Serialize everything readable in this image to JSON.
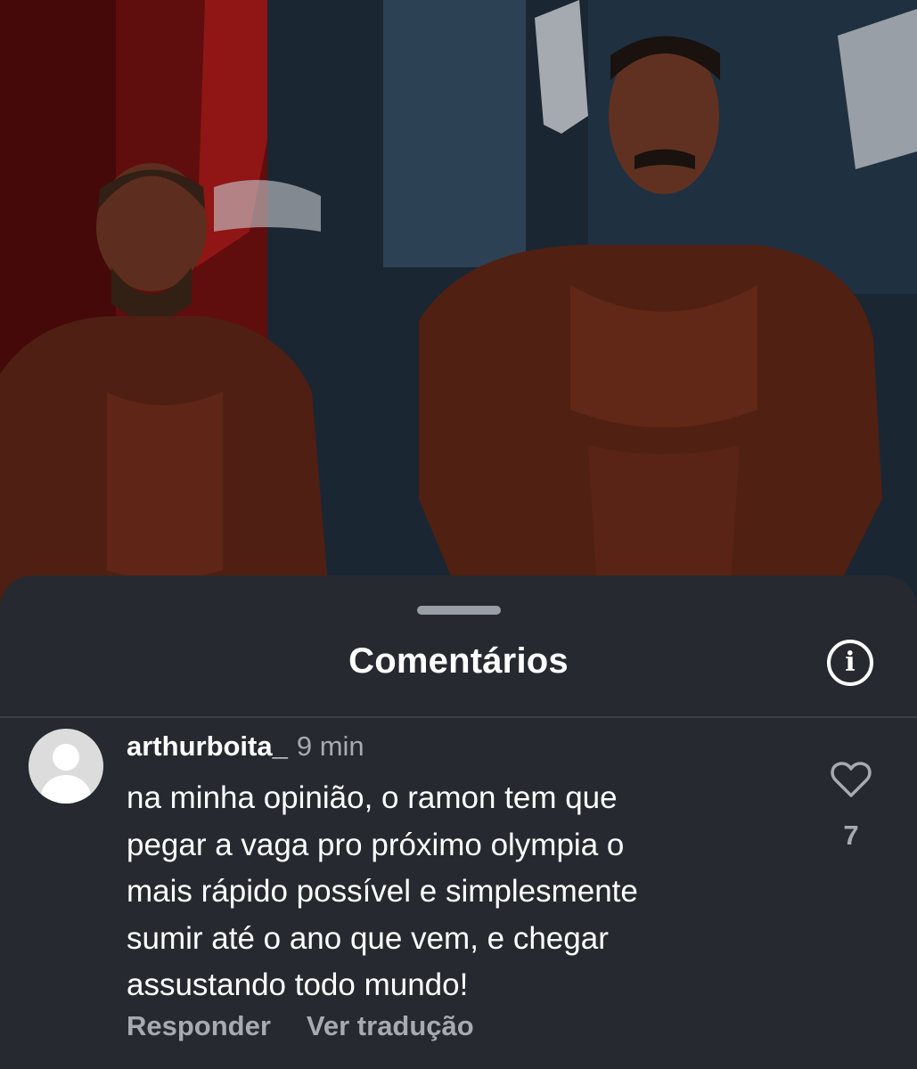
{
  "sheet": {
    "title": "Comentários",
    "info_icon": "info-icon",
    "info_glyph": "i"
  },
  "comment": {
    "avatar_icon": "default-avatar-icon",
    "username": "arthurboita_",
    "timestamp": "9 min",
    "text_lines": [
      "na minha opinião, o ramon tem que",
      "pegar a vaga pro próximo olympia o",
      "mais rápido possível e simplesmente",
      "sumir até o ano que vem, e chegar",
      "assustando todo mundo!"
    ],
    "like_icon": "heart-outline-icon",
    "like_count": "7",
    "reply_label": "Responder",
    "translate_label": "Ver tradução"
  },
  "colors": {
    "sheet_background": "#262a30",
    "primary_text": "#ffffff",
    "secondary_text": "#a6aab2"
  }
}
